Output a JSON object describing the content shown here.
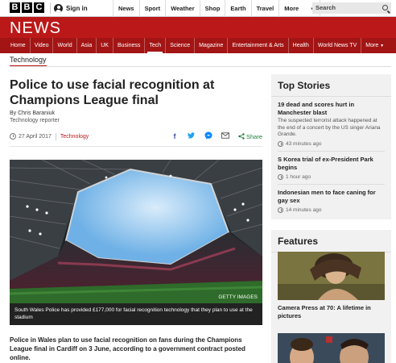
{
  "global": {
    "logo_letters": [
      "B",
      "B",
      "C"
    ],
    "signin": "Sign in",
    "nav": [
      "News",
      "Sport",
      "Weather",
      "Shop",
      "Earth",
      "Travel",
      "More"
    ],
    "search_placeholder": "Search"
  },
  "news": {
    "title": "NEWS",
    "nav": [
      "Home",
      "Video",
      "World",
      "Asia",
      "UK",
      "Business",
      "Tech",
      "Science",
      "Magazine",
      "Entertainment & Arts",
      "Health",
      "World News TV",
      "More"
    ],
    "active_nav": "Tech"
  },
  "section": "Technology",
  "article": {
    "headline": "Police to use facial recognition at Champions League final",
    "author": "By Chris Baraniuk",
    "role": "Technology reporter",
    "date": "27 April 2017",
    "tag": "Technology",
    "share_label": "Share",
    "share_icons": [
      "facebook-icon",
      "twitter-icon",
      "messenger-icon",
      "email-icon",
      "share-icon"
    ],
    "image_credit": "GETTY IMAGES",
    "caption": "South Wales Police has provided £177,000 for facial recognition technology that they plan to use at the stadium",
    "lead": "Police in Wales plan to use facial recognition on fans during the Champions League final in Cardiff on 3 June, according to a government contract posted online."
  },
  "top_stories": {
    "title": "Top Stories",
    "items": [
      {
        "title": "19 dead and scores hurt in Manchester blast",
        "summary": "The suspected terrorist attack happened at the end of a concert by the US singer Ariana Grande.",
        "time": "43 minutes ago"
      },
      {
        "title": "S Korea trial of ex-President Park begins",
        "summary": "",
        "time": "1 hour ago"
      },
      {
        "title": "Indonesian men to face caning for gay sex",
        "summary": "",
        "time": "14 minutes ago"
      }
    ]
  },
  "features": {
    "title": "Features",
    "items": [
      {
        "title": "Camera Press at 70: A lifetime in pictures"
      }
    ]
  },
  "colors": {
    "brand_red": "#bb1919",
    "nav_red": "#a31515",
    "share_green": "#1a7f37",
    "sidebar_bg": "#f1f1f1"
  }
}
